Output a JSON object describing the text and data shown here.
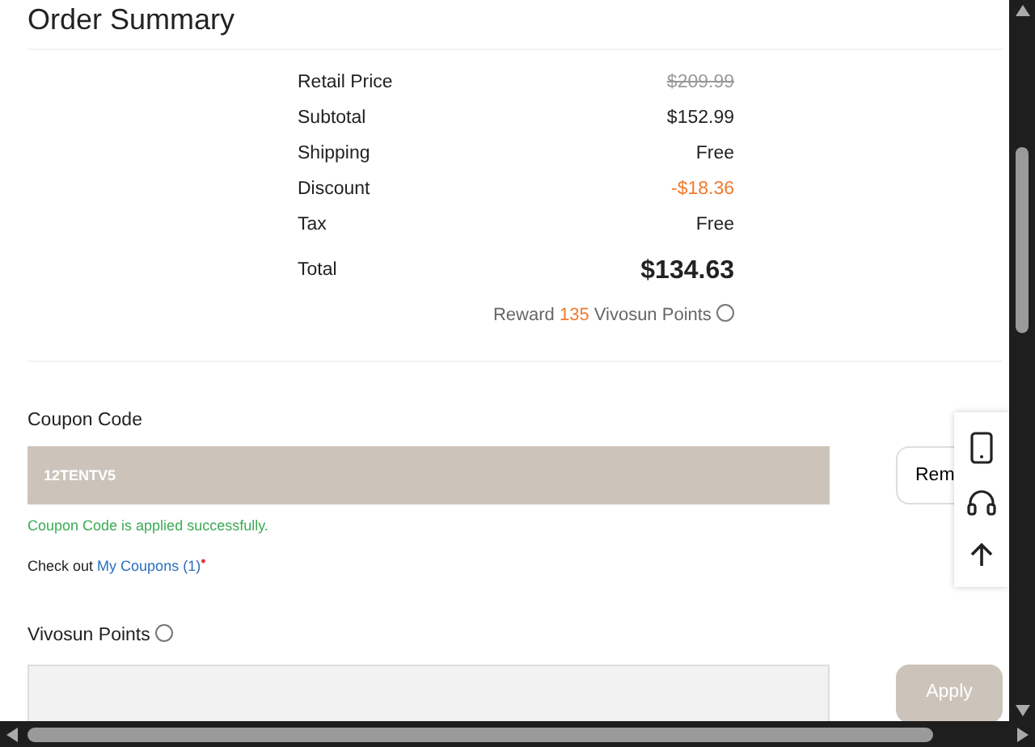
{
  "title": "Order Summary",
  "summary": [
    {
      "label": "Retail Price",
      "value": "$209.99",
      "kind": "strike"
    },
    {
      "label": "Subtotal",
      "value": "$152.99",
      "kind": "plain"
    },
    {
      "label": "Shipping",
      "value": "Free",
      "kind": "plain"
    },
    {
      "label": "Discount",
      "value": "-$18.36",
      "kind": "discount"
    },
    {
      "label": "Tax",
      "value": "Free",
      "kind": "plain"
    },
    {
      "label": "Total",
      "value": "$134.63",
      "kind": "total"
    }
  ],
  "reward": {
    "prefix": "Reward",
    "points": "135",
    "suffix": "Vivosun Points"
  },
  "coupon": {
    "label": "Coupon Code",
    "value": "12TENTV5",
    "button": "Rem",
    "message": "Coupon Code is applied successfully.",
    "checkout_prefix": "Check out",
    "checkout_link": "My Coupons (1)",
    "dot": "•"
  },
  "points": {
    "label": "Vivosun Points",
    "button": "Apply",
    "disabled": true
  }
}
